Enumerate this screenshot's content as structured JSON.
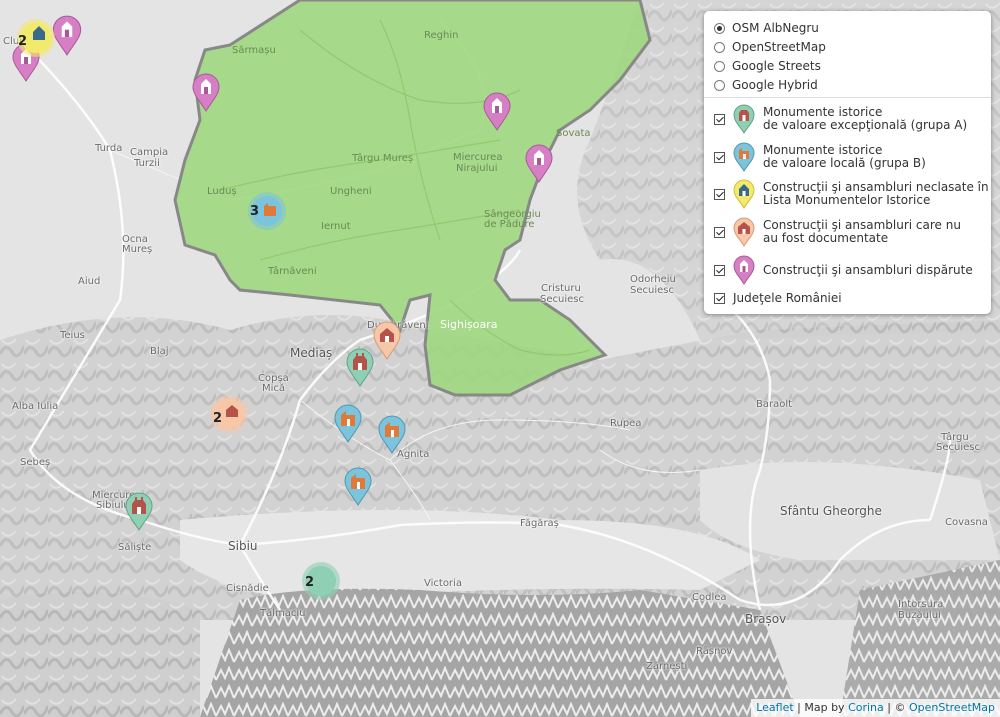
{
  "colors": {
    "county_fill": "#9fd77e",
    "county_border": "#888888",
    "group_a": "#8fcfb4",
    "group_b": "#7cc3dc",
    "neclasate": "#f2ea6a",
    "nedocumentate": "#f7c8a8",
    "disparute": "#d67fc4"
  },
  "layer_control": {
    "base_layers": [
      {
        "label": "OSM AlbNegru",
        "checked": true
      },
      {
        "label": "OpenStreetMap",
        "checked": false
      },
      {
        "label": "Google Streets",
        "checked": false
      },
      {
        "label": "Google Hybrid",
        "checked": false
      }
    ],
    "overlays": [
      {
        "label": "Monumente istorice\nde valoare excepţională (grupa A)",
        "icon": "monument-group-a-icon",
        "checked": true
      },
      {
        "label": "Monumente istorice\nde valoare locală (grupa B)",
        "icon": "monument-group-b-icon",
        "checked": true
      },
      {
        "label": "Construcţii şi ansambluri neclasate în\nLista Monumentelor Istorice",
        "icon": "unlisted-building-icon",
        "checked": true
      },
      {
        "label": "Construcţii şi ansambluri care nu\nau fost documentate",
        "icon": "undocumented-building-icon",
        "checked": true
      },
      {
        "label": "Construcţii şi ansambluri dispărute",
        "icon": "disappeared-building-icon",
        "checked": true
      },
      {
        "label": "Judeţele României",
        "icon": "",
        "checked": true
      }
    ]
  },
  "places": [
    {
      "name": "Cluj",
      "cls": ""
    },
    {
      "name": "Turda",
      "cls": ""
    },
    {
      "name": "Campia",
      "cls": ""
    },
    {
      "name": "Turzii",
      "cls": ""
    },
    {
      "name": "Ocna",
      "cls": ""
    },
    {
      "name": "Mureș",
      "cls": ""
    },
    {
      "name": "Aiud",
      "cls": ""
    },
    {
      "name": "Teius",
      "cls": ""
    },
    {
      "name": "Blaj",
      "cls": ""
    },
    {
      "name": "Alba Iulia",
      "cls": ""
    },
    {
      "name": "Sebeș",
      "cls": ""
    },
    {
      "name": "Miercurea",
      "cls": ""
    },
    {
      "name": "Sibiului",
      "cls": ""
    },
    {
      "name": "Săliște",
      "cls": ""
    },
    {
      "name": "Sibiu",
      "cls": "big"
    },
    {
      "name": "Cisnădie",
      "cls": ""
    },
    {
      "name": "Tălmaciu",
      "cls": ""
    },
    {
      "name": "Victoria",
      "cls": ""
    },
    {
      "name": "Făgăraș",
      "cls": ""
    },
    {
      "name": "Codlea",
      "cls": ""
    },
    {
      "name": "Brașov",
      "cls": "big"
    },
    {
      "name": "Râsnov",
      "cls": ""
    },
    {
      "name": "Zărnești",
      "cls": ""
    },
    {
      "name": "Intorsura",
      "cls": ""
    },
    {
      "name": "Buzăului",
      "cls": ""
    },
    {
      "name": "Covasna",
      "cls": ""
    },
    {
      "name": "Sfântu Gheorghe",
      "cls": "big"
    },
    {
      "name": "Târgu",
      "cls": ""
    },
    {
      "name": "Secuiesc",
      "cls": ""
    },
    {
      "name": "Baraolt",
      "cls": ""
    },
    {
      "name": "Rupea",
      "cls": ""
    },
    {
      "name": "Agnita",
      "cls": ""
    },
    {
      "name": "Copșa",
      "cls": ""
    },
    {
      "name": "Mică",
      "cls": ""
    },
    {
      "name": "Mediaș",
      "cls": "big"
    },
    {
      "name": "Dumbrăveni",
      "cls": ""
    },
    {
      "name": "Cristuru",
      "cls": ""
    },
    {
      "name": "Secuiesc",
      "cls": ""
    },
    {
      "name": "Odorheiu",
      "cls": ""
    },
    {
      "name": "Secuiesc",
      "cls": ""
    },
    {
      "name": "Sighișoara",
      "cls": "white"
    },
    {
      "name": "Târnăveni",
      "cls": "green"
    },
    {
      "name": "Luduș",
      "cls": "green"
    },
    {
      "name": "Ungheni",
      "cls": "green"
    },
    {
      "name": "Târgu Mureș",
      "cls": "green"
    },
    {
      "name": "Miercurea",
      "cls": "green"
    },
    {
      "name": "Nirajului",
      "cls": "green"
    },
    {
      "name": "Sângeorgiu",
      "cls": "green"
    },
    {
      "name": "de Pădure",
      "cls": "green"
    },
    {
      "name": "Sovata",
      "cls": "green"
    },
    {
      "name": "Reghin",
      "cls": "green"
    },
    {
      "name": "Iernut",
      "cls": "green"
    },
    {
      "name": "Sărmașu",
      "cls": "green"
    }
  ],
  "clusters": [
    {
      "count": "3",
      "group": "group_b"
    },
    {
      "count": "2",
      "group": "nedocumentate"
    },
    {
      "count": "2",
      "group": "group_a"
    },
    {
      "count": "2",
      "group": "neclasate"
    }
  ],
  "attribution": {
    "leaflet": "Leaflet",
    "sep1": " | Map by ",
    "author": "Corina",
    "sep2": " | © ",
    "osm": "OpenStreetMap"
  }
}
